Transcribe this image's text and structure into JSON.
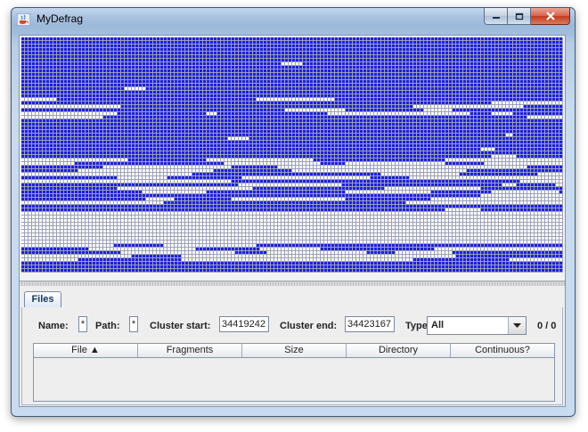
{
  "window": {
    "title": "MyDefrag",
    "controls": {
      "minimize_icon": "minimize-icon",
      "maximize_icon": "maximize-icon",
      "close_icon": "close-icon"
    }
  },
  "colors": {
    "used": "#1c1ee8",
    "free": "#ffffff",
    "grid": "#9aa0b8",
    "accent": "#1a4fd0"
  },
  "tabs": [
    {
      "label": "Files",
      "active": true
    }
  ],
  "filters": {
    "name_label": "Name:",
    "name_value": "*",
    "path_label": "Path:",
    "path_value": "*",
    "cluster_start_label": "Cluster start:",
    "cluster_start_value": "34419242",
    "cluster_end_label": "Cluster end:",
    "cluster_end_value": "34423167",
    "type_label": "Type",
    "type_value": "All",
    "count": "0 / 0"
  },
  "table": {
    "columns": [
      "File ▲",
      "Fragments",
      "Size",
      "Directory",
      "Continuous?"
    ],
    "rows": []
  }
}
